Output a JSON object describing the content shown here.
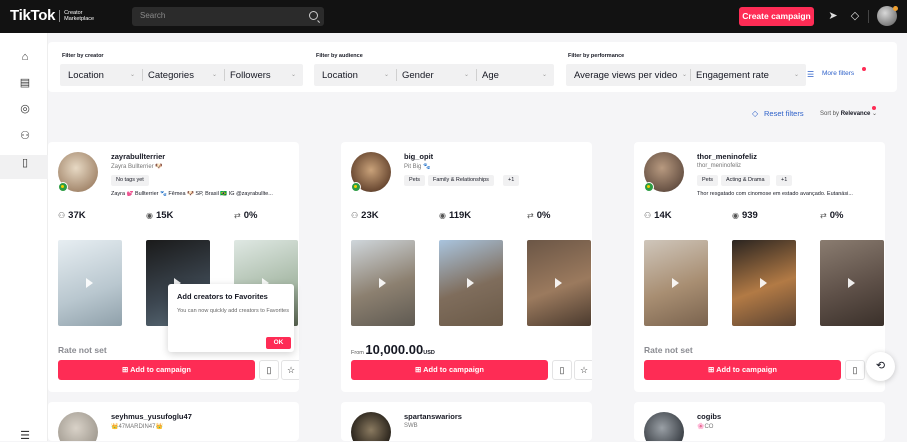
{
  "topbar": {
    "logo": "TikTok",
    "logo_sub_1": "Creator",
    "logo_sub_2": "Marketplace",
    "search_placeholder": "Search",
    "create_label": "Create campaign"
  },
  "filters": {
    "creator_title": "Filter by creator",
    "creator_items": [
      "Location",
      "Categories",
      "Followers"
    ],
    "audience_title": "Filter by audience",
    "audience_items": [
      "Location",
      "Gender",
      "Age"
    ],
    "performance_title": "Filter by performance",
    "performance_items": [
      "Average views per video",
      "Engagement rate"
    ],
    "more_filters": "More filters",
    "reset_filters": "Reset filters",
    "sort_label": "Sort by",
    "sort_value": "Relevance"
  },
  "cards": [
    {
      "name": "zayrabullterrier",
      "sub": "Zayra Bullterrier 🐶",
      "tags": [
        "No tags yet"
      ],
      "bio": "Zayra 💕 Bullterrier 🐾 Fêmea 🐶 SP, Brasil 🇧🇷 IG @zayrabullte...",
      "followers": "37K",
      "views": "15K",
      "engagement": "0%",
      "rate": "Rate not set",
      "add_label": "Add to campaign"
    },
    {
      "name": "big_opit",
      "sub": "Pit Big 🐾",
      "tags": [
        "Pets",
        "Family & Relationships",
        "+1"
      ],
      "bio": "",
      "followers": "23K",
      "views": "119K",
      "engagement": "0%",
      "price_from": "From",
      "price_value": "10,000.00",
      "price_currency": "USD",
      "add_label": "Add to campaign"
    },
    {
      "name": "thor_meninofeliz",
      "sub": "thor_meninofeliz",
      "tags": [
        "Pets",
        "Acting & Drama",
        "+1"
      ],
      "bio": "Thor resgatado com cinomose em estado avançado. Eutanási...",
      "followers": "14K",
      "views": "939",
      "engagement": "0%",
      "rate": "Rate not set",
      "add_label": "Add to campaign"
    }
  ],
  "bottom_cards": [
    {
      "name": "seyhmus_yusufoglu47",
      "sub": "👑47MARDIN47👑"
    },
    {
      "name": "spartanswariors",
      "sub": "SWB"
    },
    {
      "name": "cogibs",
      "sub": "🌸CO"
    }
  ],
  "popup": {
    "title": "Add creators to Favorites",
    "text": "You can now quickly add creators to Favorites",
    "ok": "OK"
  },
  "colors": {
    "accent": "#fe2c55",
    "link": "#2e61c9"
  }
}
